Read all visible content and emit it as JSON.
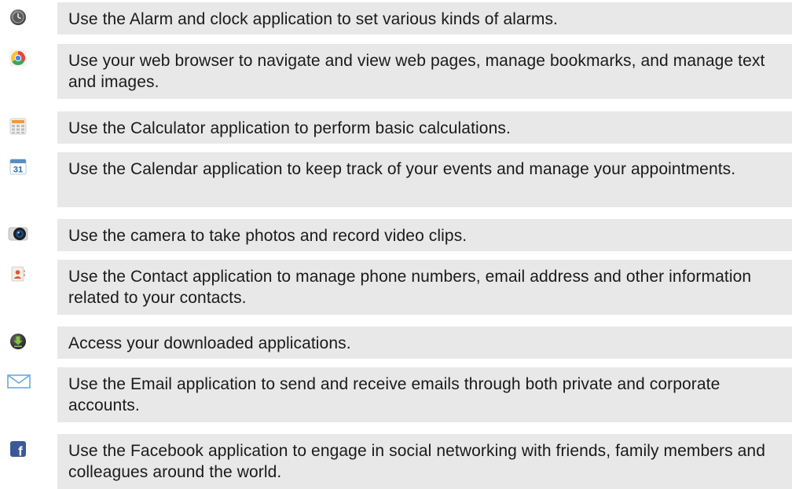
{
  "apps": [
    {
      "icon": "clock-icon",
      "description": "Use the Alarm and clock application to set various kinds of alarms."
    },
    {
      "icon": "browser-icon",
      "description": "Use your web browser to navigate and view web pages, manage bookmarks, and manage text and images."
    },
    {
      "icon": "calculator-icon",
      "description": "Use the Calculator application to perform basic calculations."
    },
    {
      "icon": "calendar-icon",
      "description": "Use the Calendar application to keep track of your events and manage your appointments.",
      "icon_text": "31"
    },
    {
      "icon": "camera-icon",
      "description": "Use the camera to take photos and record video clips."
    },
    {
      "icon": "contacts-icon",
      "description": "Use the Contact application to manage phone numbers, email address and other information related to your contacts."
    },
    {
      "icon": "downloads-icon",
      "description": "Access your downloaded applications."
    },
    {
      "icon": "email-icon",
      "description": "Use the Email application to send and receive emails through both private and corporate accounts."
    },
    {
      "icon": "facebook-icon",
      "description": "Use the Facebook application to engage in social networking with friends, family members and colleagues around the world.",
      "icon_text": "f"
    }
  ],
  "colors": {
    "row_background": "#e8e8e8",
    "text": "#1a1a1a"
  }
}
